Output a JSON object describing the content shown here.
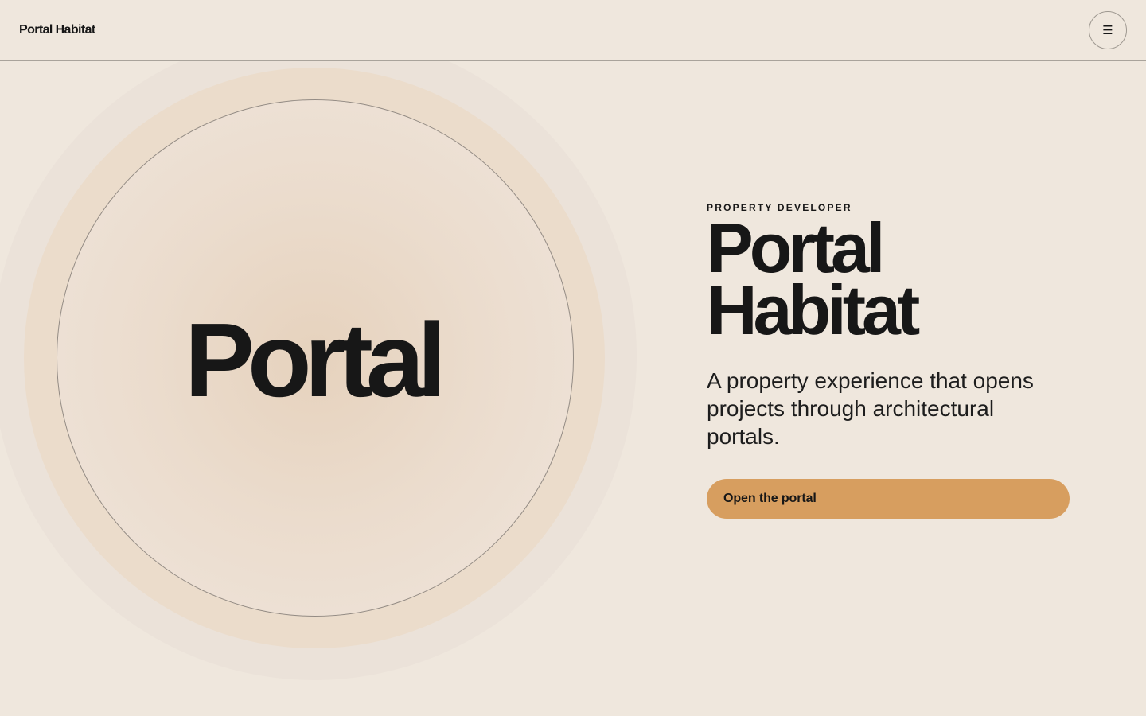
{
  "brand": {
    "name": "Portal Habitat"
  },
  "menu": {
    "icon": "hamburger-menu-icon",
    "glyph": "☰"
  },
  "portal": {
    "word": "Portal"
  },
  "hero": {
    "eyebrow": "PROPERTY DEVELOPER",
    "title_line1": "Portal",
    "title_line2": "Habitat",
    "description": "A property experience that opens projects through architectural portals.",
    "cta_label": "Open the portal"
  },
  "colors": {
    "background": "#efe7dd",
    "accent": "#d79e5f",
    "text": "#171717"
  }
}
